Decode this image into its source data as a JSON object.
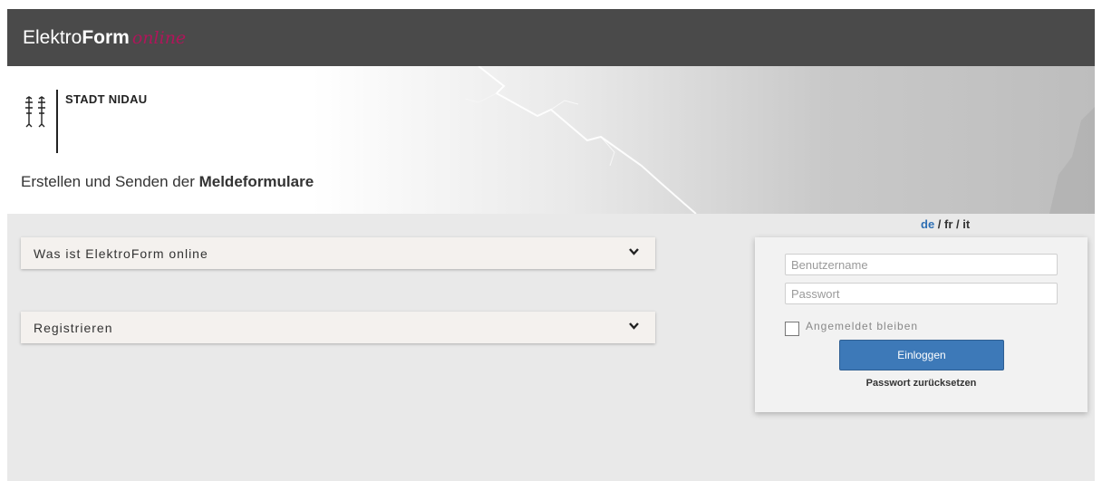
{
  "header": {
    "brand_part1": "Elektro",
    "brand_part2": "Form",
    "brand_part3": "online"
  },
  "banner": {
    "crest_icon": "nidau-crest-icon",
    "city": "STADT NIDAU",
    "subtitle_prefix": "Erstellen und Senden der",
    "subtitle_bold": "Meldeformulare"
  },
  "language": {
    "de": "de",
    "separator1": " / ",
    "fr": "fr",
    "separator2": " / ",
    "it": "it",
    "active": "de"
  },
  "accordions": [
    {
      "label": "Was ist ElektroForm online",
      "icon": "chevron-down-icon"
    },
    {
      "label": "Registrieren",
      "icon": "chevron-down-icon"
    }
  ],
  "login": {
    "username_placeholder": "Benutzername",
    "password_placeholder": "Passwort",
    "remember_label": "Angemeldet bleiben",
    "submit_label": "Einloggen",
    "reset_label": "Passwort zurücksetzen"
  },
  "colors": {
    "topbar": "#4a4a4a",
    "accent": "#b0155a",
    "button": "#3d79b8",
    "link_active": "#2e6fb3"
  }
}
